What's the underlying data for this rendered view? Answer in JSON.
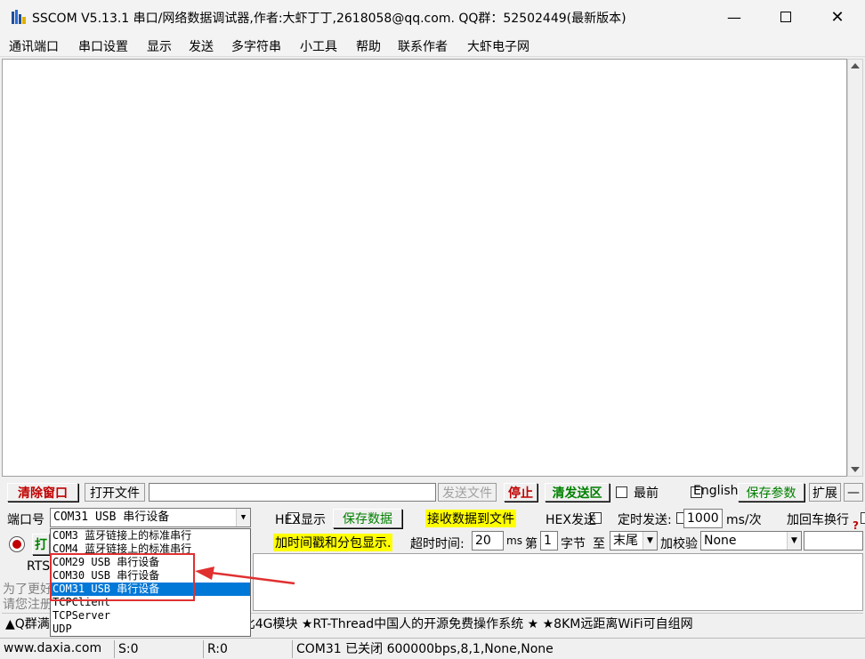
{
  "window": {
    "title": "SSCOM V5.13.1 串口/网络数据调试器,作者:大虾丁丁,2618058@qq.com. QQ群：52502449(最新版本)"
  },
  "menu": [
    "通讯端口",
    "串口设置",
    "显示",
    "发送",
    "多字符串",
    "小工具",
    "帮助",
    "联系作者",
    "大虾电子网"
  ],
  "toolbar": {
    "clear_window": "清除窗口",
    "open_file": "打开文件",
    "send_file": "发送文件",
    "stop": "停止",
    "clear_send": "清发送区",
    "topmost": "最前",
    "english": "English",
    "save_params": "保存参数",
    "expand": "扩展",
    "collapse": "—"
  },
  "port": {
    "label": "端口号",
    "selected": "COM31 USB 串行设备",
    "open_button_partial": "打",
    "rts_label": "RTS"
  },
  "dropdown_options": [
    "COM3 蓝牙链接上的标准串行",
    "COM4 蓝牙链接上的标准串行",
    "COM29 USB 串行设备",
    "COM30 USB 串行设备",
    "COM31 USB 串行设备",
    "TCPClient",
    "TCPServer",
    "UDP"
  ],
  "options_row1": {
    "hex_display": "HEX显示",
    "save_data": "保存数据",
    "recv_to_file": "接收数据到文件",
    "hex_send": "HEX发送",
    "timed_send": "定时发送:",
    "interval": "1000",
    "interval_unit": "ms/次",
    "add_crlf": "加回车换行"
  },
  "options_row2": {
    "timestamp": "加时间戳和分包显示.",
    "timeout_label": "超时时间:",
    "timeout": "20",
    "timeout_unit": "ms",
    "nth_label": "第",
    "nth_value": "1",
    "byte_label": "字节",
    "to_label": "至",
    "end_value": "末尾",
    "checksum_label": "加校验",
    "checksum_value": "None"
  },
  "left_info": {
    "line1": "为了更好",
    "line2": "请您注册"
  },
  "ticker": {
    "prefix": "▲Q群满",
    "text": "比4G模块 ★RT-Thread中国人的开源免费操作系统 ★ ★8KM远距离WiFi可自组网"
  },
  "status": {
    "site": "www.daxia.com",
    "sent": "S:0",
    "received": "R:0",
    "port_status": "COM31 已关闭  600000bps,8,1,None,None"
  },
  "colors": {
    "highlight_yellow": "#ffff00",
    "selection_blue": "#0078d7",
    "annotation_red": "#e03030",
    "button_red_text": "#c00000",
    "button_green_text": "#008000"
  },
  "checkboxes": {
    "topmost": false,
    "english": false,
    "hex_display": false,
    "recv_to_file": true,
    "hex_send": false,
    "timed_send": false,
    "add_crlf": false,
    "timestamp": true,
    "rts": false
  }
}
